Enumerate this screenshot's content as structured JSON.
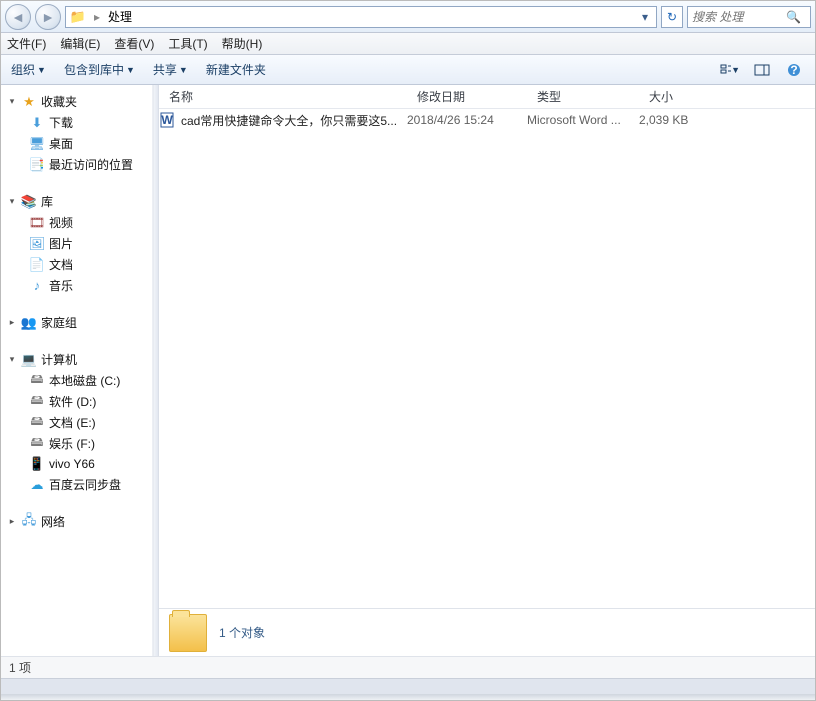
{
  "nav": {
    "path_root_label": "",
    "path_current": "处理",
    "search_placeholder": "搜索 处理"
  },
  "menubar": {
    "file": "文件(F)",
    "edit": "编辑(E)",
    "view": "查看(V)",
    "tools": "工具(T)",
    "help": "帮助(H)"
  },
  "toolbar": {
    "organize": "组织",
    "include": "包含到库中",
    "share": "共享",
    "new_folder": "新建文件夹"
  },
  "sidebar": {
    "favorites": {
      "label": "收藏夹",
      "items": [
        {
          "icon": "download-icon",
          "label": "下载"
        },
        {
          "icon": "desktop-icon",
          "label": "桌面"
        },
        {
          "icon": "recent-icon",
          "label": "最近访问的位置"
        }
      ]
    },
    "libraries": {
      "label": "库",
      "items": [
        {
          "icon": "video-icon",
          "label": "视频"
        },
        {
          "icon": "pictures-icon",
          "label": "图片"
        },
        {
          "icon": "documents-icon",
          "label": "文档"
        },
        {
          "icon": "music-icon",
          "label": "音乐"
        }
      ]
    },
    "homegroup": {
      "label": "家庭组"
    },
    "computer": {
      "label": "计算机",
      "items": [
        {
          "icon": "drive-icon",
          "label": "本地磁盘 (C:)"
        },
        {
          "icon": "drive-icon",
          "label": "软件 (D:)"
        },
        {
          "icon": "drive-icon",
          "label": "文档 (E:)"
        },
        {
          "icon": "drive-icon",
          "label": "娱乐 (F:)"
        },
        {
          "icon": "drive-icon",
          "label": "vivo Y66"
        },
        {
          "icon": "sync-icon",
          "label": "百度云同步盘"
        }
      ]
    },
    "network": {
      "label": "网络"
    }
  },
  "columns": {
    "name": "名称",
    "date": "修改日期",
    "type": "类型",
    "size": "大小"
  },
  "files": [
    {
      "icon": "word-doc-icon",
      "name": "cad常用快捷键命令大全，你只需要这5...",
      "date": "2018/4/26 15:24",
      "type": "Microsoft Word ...",
      "size": "2,039 KB"
    }
  ],
  "details": {
    "summary": "1 个对象"
  },
  "status": {
    "text": "1 项"
  }
}
